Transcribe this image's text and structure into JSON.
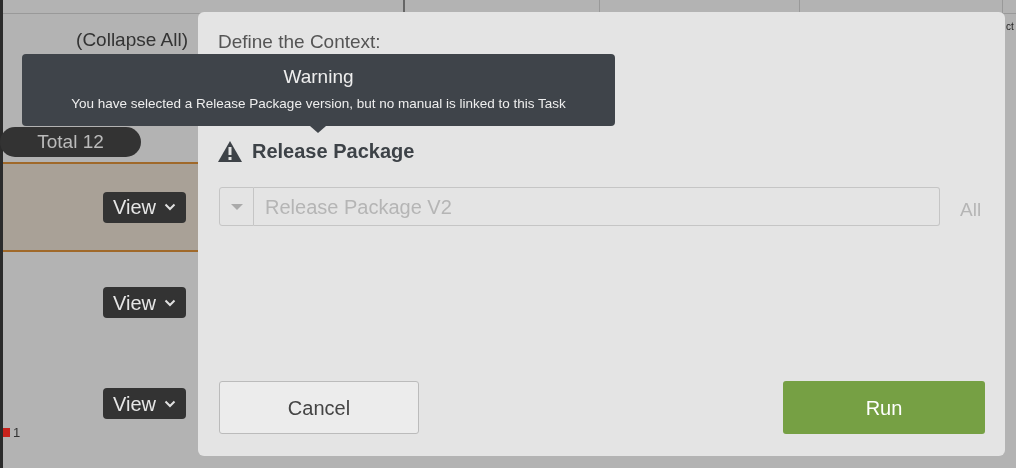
{
  "background": {
    "collapse_link": "(Collapse All)",
    "total_badge": "Total 12",
    "cut_text": "ct",
    "rows": [
      {
        "selected": true,
        "button": "View"
      },
      {
        "selected": false,
        "button": "View"
      },
      {
        "selected": false,
        "button": "View",
        "flag_count": "1"
      }
    ]
  },
  "dialog": {
    "heading": "Define the Context:",
    "section_title": "Release Package",
    "field": {
      "placeholder": "Release Package V2"
    },
    "scope_label": "All",
    "buttons": [
      {
        "label": "Cancel",
        "kind": "secondary"
      },
      {
        "label": "Run",
        "kind": "primary"
      }
    ]
  },
  "tooltip": {
    "title": "Warning",
    "message": "You have selected a Release Package version, but no manual is linked to this Task"
  }
}
